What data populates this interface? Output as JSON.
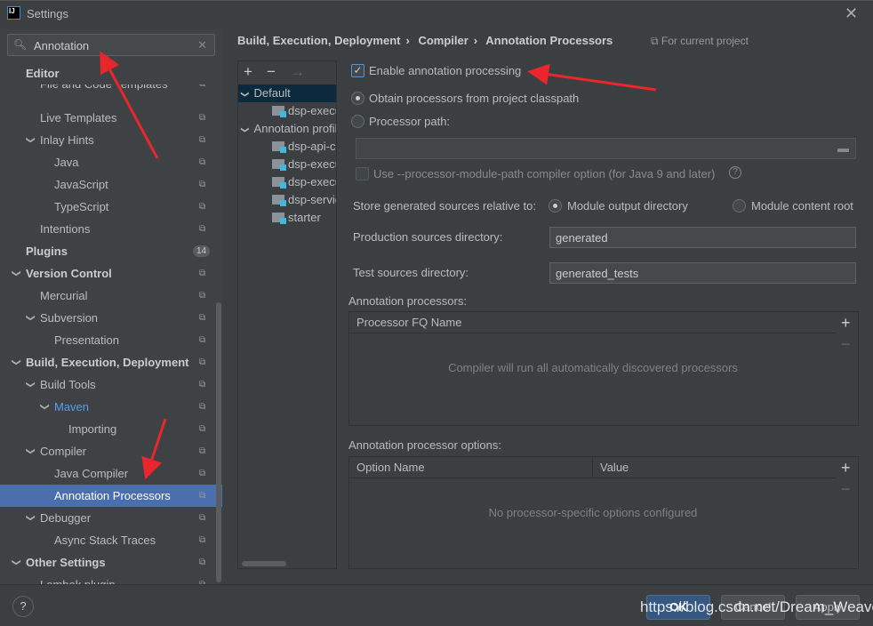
{
  "window": {
    "title": "Settings",
    "logo": "IJ",
    "close": "✕"
  },
  "search": {
    "value": "Annotation",
    "icon": "search-icon",
    "clear": "✕"
  },
  "sidebar": {
    "items": [
      {
        "label": "Editor",
        "level": 0,
        "bold": true
      },
      {
        "label": "File and Code Templates",
        "level": 1
      },
      {
        "label": "Live Templates",
        "level": 1
      },
      {
        "label": "Inlay Hints",
        "level": 1,
        "expanded": true
      },
      {
        "label": "Java",
        "level": 2
      },
      {
        "label": "JavaScript",
        "level": 2
      },
      {
        "label": "TypeScript",
        "level": 2
      },
      {
        "label": "Intentions",
        "level": 1
      },
      {
        "label": "Plugins",
        "level": 0,
        "bold": true,
        "badge": "14"
      },
      {
        "label": "Version Control",
        "level": 0,
        "bold": true,
        "expanded": true
      },
      {
        "label": "Mercurial",
        "level": 1
      },
      {
        "label": "Subversion",
        "level": 1,
        "expanded": true
      },
      {
        "label": "Presentation",
        "level": 2
      },
      {
        "label": "Build, Execution, Deployment",
        "level": 0,
        "bold": true,
        "expanded": true
      },
      {
        "label": "Build Tools",
        "level": 1,
        "expanded": true
      },
      {
        "label": "Maven",
        "level": 2,
        "expanded": true,
        "accent": true
      },
      {
        "label": "Importing",
        "level": 3
      },
      {
        "label": "Compiler",
        "level": 1,
        "expanded": true
      },
      {
        "label": "Java Compiler",
        "level": 2
      },
      {
        "label": "Annotation Processors",
        "level": 2,
        "selected": true
      },
      {
        "label": "Debugger",
        "level": 1,
        "expanded": true
      },
      {
        "label": "Async Stack Traces",
        "level": 2
      },
      {
        "label": "Other Settings",
        "level": 0,
        "bold": true,
        "expanded": true
      },
      {
        "label": "Lombok plugin",
        "level": 1
      }
    ]
  },
  "breadcrumb": [
    "Build, Execution, Deployment",
    "Compiler",
    "Annotation Processors"
  ],
  "for_project": "For current project",
  "profiles": {
    "tools": [
      "+",
      "−",
      "→"
    ],
    "nodes": [
      {
        "label": "Default",
        "level": 0,
        "selected": true
      },
      {
        "label": "dsp-executor",
        "level": 1
      },
      {
        "label": "Annotation profile",
        "level": 0
      },
      {
        "label": "dsp-api-common",
        "level": 1
      },
      {
        "label": "dsp-executor",
        "level": 1
      },
      {
        "label": "dsp-executor",
        "level": 1
      },
      {
        "label": "dsp-service",
        "level": 1
      },
      {
        "label": "starter",
        "level": 1
      }
    ]
  },
  "form": {
    "enable_label": "Enable annotation processing",
    "enable_checked": true,
    "obtain_label": "Obtain processors from project classpath",
    "path_label": "Processor path:",
    "path_value": "",
    "module_path_label": "Use --processor-module-path compiler option (for Java 9 and later)",
    "store_label": "Store generated sources relative to:",
    "module_output": "Module output directory",
    "module_content": "Module content root",
    "prod_label": "Production sources directory:",
    "prod_value": "generated",
    "test_label": "Test sources directory:",
    "test_value": "generated_tests",
    "proc_title": "Annotation processors:",
    "proc_col": "Processor FQ Name",
    "proc_empty": "Compiler will run all automatically discovered processors",
    "opt_title": "Annotation processor options:",
    "opt_cols": [
      "Option Name",
      "Value"
    ],
    "opt_empty": "No processor-specific options configured"
  },
  "footer": {
    "help": "?",
    "ok": "OK",
    "cancel": "Cancel",
    "apply": "Apply"
  },
  "watermark": "https://blog.csdn.net/Dream_Weave",
  "colors": {
    "selection": "#4b6eaf",
    "accent": "#589df6",
    "annotation_arrow": "#e8262b"
  }
}
